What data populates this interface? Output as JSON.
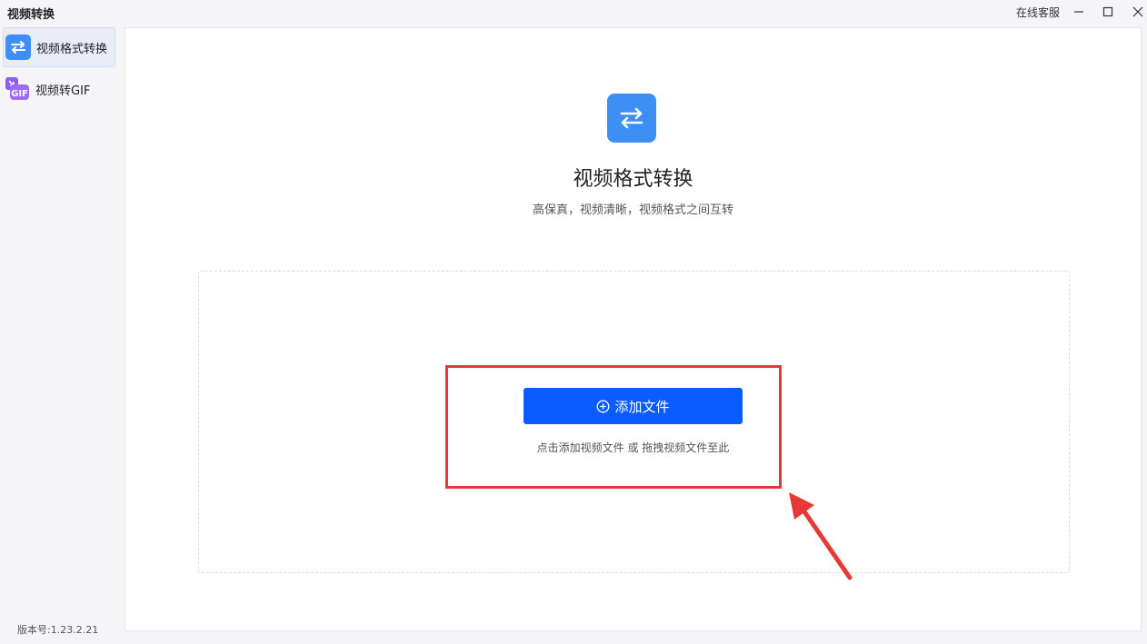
{
  "window": {
    "title": "视频转换",
    "service_label": "在线客服",
    "controls": [
      "minimize-icon",
      "maximize-icon",
      "close-icon"
    ]
  },
  "sidebar": {
    "items": [
      {
        "label": "视频格式转换",
        "icon": "swap-arrows-icon",
        "active": true,
        "icon_color": "#3d8ef5"
      },
      {
        "label": "视频转GIF",
        "icon": "gif-icon",
        "active": false,
        "icon_color": "#8c5cf2"
      }
    ],
    "version": "版本号:1.23.2.21"
  },
  "main": {
    "hero_icon": "swap-arrows-icon",
    "title": "视频格式转换",
    "subtitle": "高保真，视频清晰，视频格式之间互转",
    "add_button_label": "添加文件",
    "hint": "点击添加视频文件 或 拖拽视频文件至此"
  },
  "colors": {
    "accent": "#0b5cff",
    "icon_blue": "#3d8ef5",
    "annotation_red": "#e53935"
  }
}
